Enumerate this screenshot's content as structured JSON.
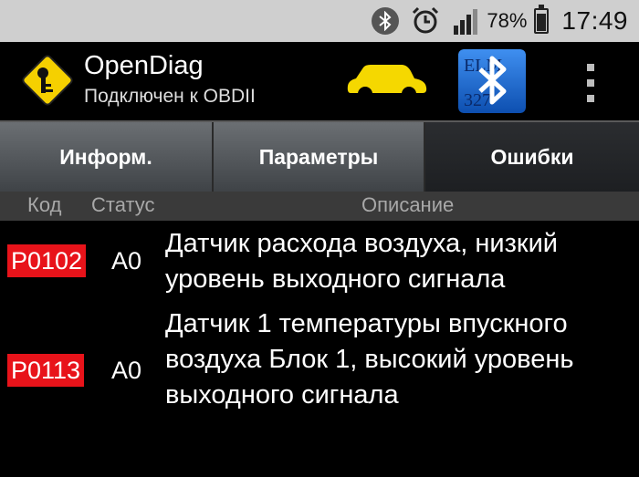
{
  "status_bar": {
    "battery_percent": "78%",
    "time": "17:49",
    "icons": [
      "bluetooth-icon",
      "alarm-icon",
      "signal-icon",
      "battery-icon"
    ]
  },
  "action_bar": {
    "title": "OpenDiag",
    "subtitle": "Подключен к OBDII",
    "icons": [
      "app-logo-icon",
      "car-icon",
      "elm327-bluetooth-icon",
      "overflow-menu-icon"
    ],
    "colors": {
      "car": "#f5d800",
      "elm_logo_bg": "#1b6fd6"
    }
  },
  "tabs": [
    {
      "label": "Информ."
    },
    {
      "label": "Параметры"
    },
    {
      "label": "Ошибки",
      "selected": true
    }
  ],
  "table": {
    "headers": {
      "code": "Код",
      "status": "Статус",
      "description": "Описание"
    },
    "rows": [
      {
        "code": "P0102",
        "status": "A0",
        "description": "Датчик расхода воздуха, низкий уровень выходного сигнала"
      },
      {
        "code": "P0113",
        "status": "A0",
        "description": "Датчик 1 температуры впускного воздуха Блок 1, высокий уровень выходного сигнала"
      }
    ],
    "colors": {
      "code_badge": "#e8131a"
    }
  }
}
